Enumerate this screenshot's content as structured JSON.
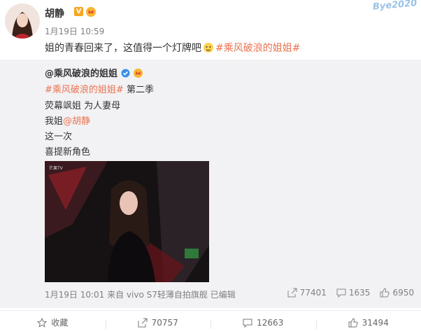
{
  "post": {
    "author": "胡静",
    "watermark": "Bye2020",
    "time": "1月19日 10:59",
    "text": "姐的青春回来了，这值得一个灯牌吧",
    "hashtag": "#乘风破浪的姐姐#"
  },
  "repost": {
    "author": "@乘风破浪的姐姐",
    "hashtag": "#乘风破浪的姐姐#",
    "season": "第二季",
    "line2": "荧幕飒姐 为人妻母",
    "line3_prefix": "我姐",
    "line3_mention": "@胡静",
    "line4": "这一次",
    "line5": "喜提新角色",
    "footer": "1月19日 10:01 来自 vivo S7轻薄自拍旗舰  已编辑",
    "reposts": "77401",
    "comments": "1635",
    "likes": "6950"
  },
  "actions": {
    "favorite": "收藏",
    "repost": "70757",
    "comment": "12663",
    "like": "31494"
  }
}
